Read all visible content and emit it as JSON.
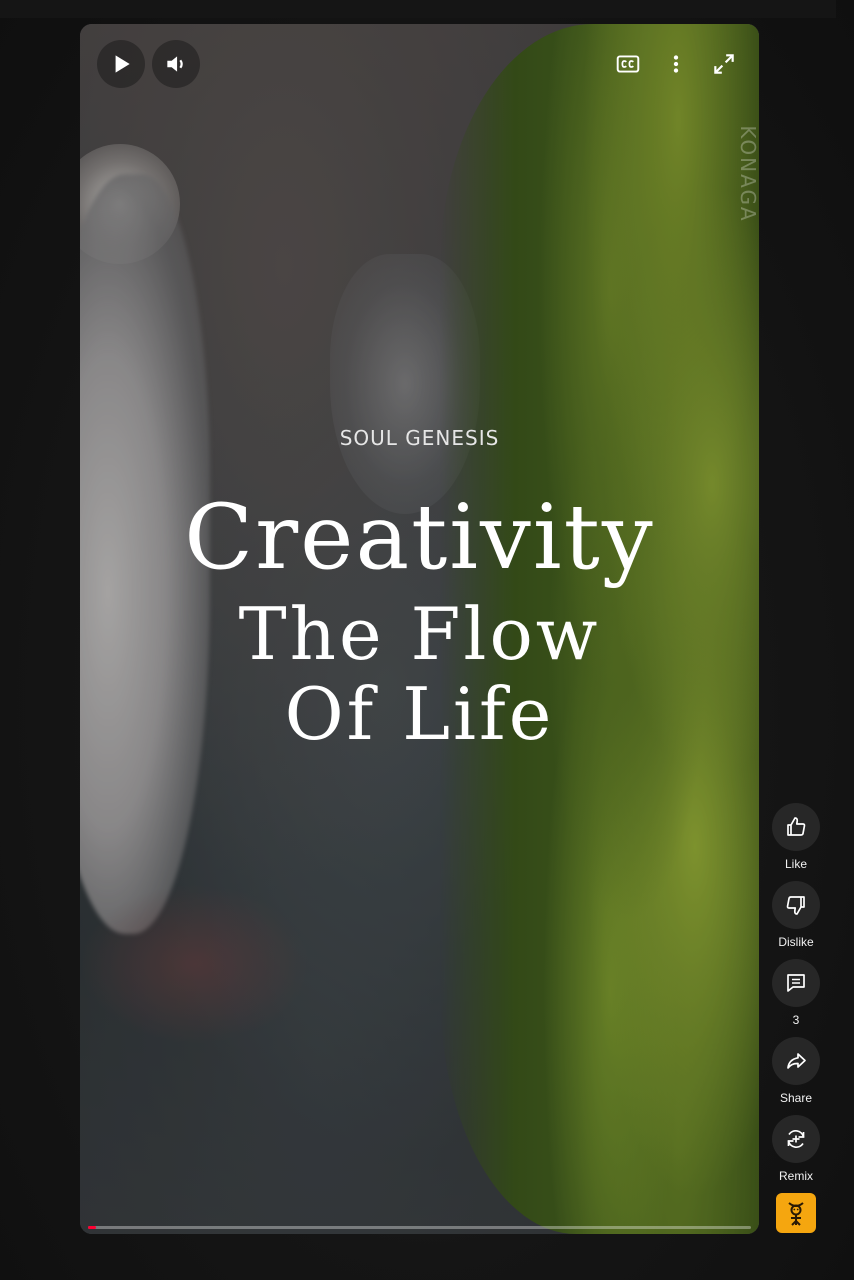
{
  "video": {
    "watermark": "KONAGA",
    "overlay_subtitle": "SOUL GENESIS",
    "overlay_title_line1": "Creativity",
    "overlay_title_line2": "The Flow",
    "overlay_title_line3": "Of Life",
    "progress": 0.012
  },
  "player_controls": {
    "play_icon": "play-icon",
    "volume_icon": "volume-icon",
    "captions_icon": "closed-captions-icon",
    "more_icon": "more-vertical-icon",
    "fullscreen_icon": "fullscreen-icon"
  },
  "actions": {
    "like": {
      "label": "Like",
      "icon": "thumbs-up-icon"
    },
    "dislike": {
      "label": "Dislike",
      "icon": "thumbs-down-icon"
    },
    "comments": {
      "label": "3",
      "icon": "comment-icon"
    },
    "share": {
      "label": "Share",
      "icon": "share-icon"
    },
    "remix": {
      "label": "Remix",
      "icon": "remix-icon"
    }
  },
  "colors": {
    "progress": "#ff0033",
    "background": "#0f0f0f",
    "action_button": "#272727",
    "channel_thumb": "#f5a60f"
  }
}
